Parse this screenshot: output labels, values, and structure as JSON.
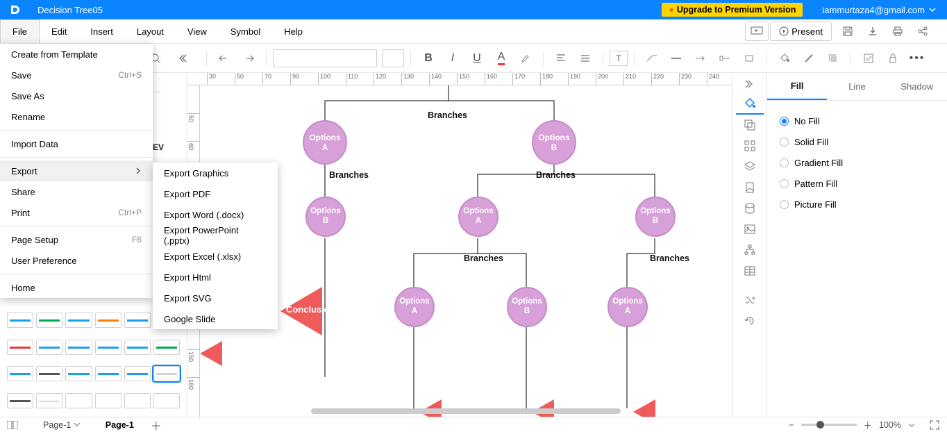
{
  "titlebar": {
    "doc_title": "Decision Tree05",
    "upgrade_label": "Upgrade to Premium Version",
    "user_email": "iammurtaza4@gmail.com"
  },
  "menubar": {
    "items": [
      "File",
      "Edit",
      "Insert",
      "Layout",
      "View",
      "Symbol",
      "Help"
    ],
    "present_label": "Present"
  },
  "file_menu": {
    "items": [
      {
        "label": "Create from Template",
        "shortcut": ""
      },
      {
        "label": "Save",
        "shortcut": "Ctrl+S"
      },
      {
        "label": "Save As",
        "shortcut": ""
      },
      {
        "label": "Rename",
        "shortcut": ""
      },
      {
        "sep": true
      },
      {
        "label": "Import Data",
        "shortcut": ""
      },
      {
        "sep": true
      },
      {
        "label": "Export",
        "shortcut": "",
        "submenu": true,
        "hover": true
      },
      {
        "label": "Share",
        "shortcut": ""
      },
      {
        "label": "Print",
        "shortcut": "Ctrl+P"
      },
      {
        "sep": true
      },
      {
        "label": "Page Setup",
        "shortcut": "F6"
      },
      {
        "label": "User Preference",
        "shortcut": ""
      },
      {
        "sep": true
      },
      {
        "label": "Home",
        "shortcut": ""
      }
    ]
  },
  "export_submenu": {
    "items": [
      "Export Graphics",
      "Export PDF",
      "Export Word (.docx)",
      "Export PowerPoint (.pptx)",
      "Export Excel (.xlsx)",
      "Export Html",
      "Export SVG",
      "Google Slide"
    ]
  },
  "right_panel": {
    "tabs": [
      "Fill",
      "Line",
      "Shadow"
    ],
    "options": [
      "No Fill",
      "Solid Fill",
      "Gradient Fill",
      "Pattern Fill",
      "Picture Fill"
    ],
    "selected": "No Fill"
  },
  "ruler_h": [
    "30",
    "50",
    "70",
    "90",
    "100",
    "110",
    "120",
    "130",
    "140",
    "150",
    "160",
    "170",
    "180",
    "190",
    "200",
    "210",
    "220",
    "230",
    "240"
  ],
  "ruler_v": [
    "50",
    "60",
    "150",
    "160"
  ],
  "canvas": {
    "branches_label": "Branches",
    "conclusion_label": "Conclusion",
    "option_a": "Options\nA",
    "option_b": "Options\nB",
    "ev_stub": "EV"
  },
  "page_tabs": {
    "selector": "Page-1",
    "active": "Page-1",
    "zoom": "100%"
  }
}
